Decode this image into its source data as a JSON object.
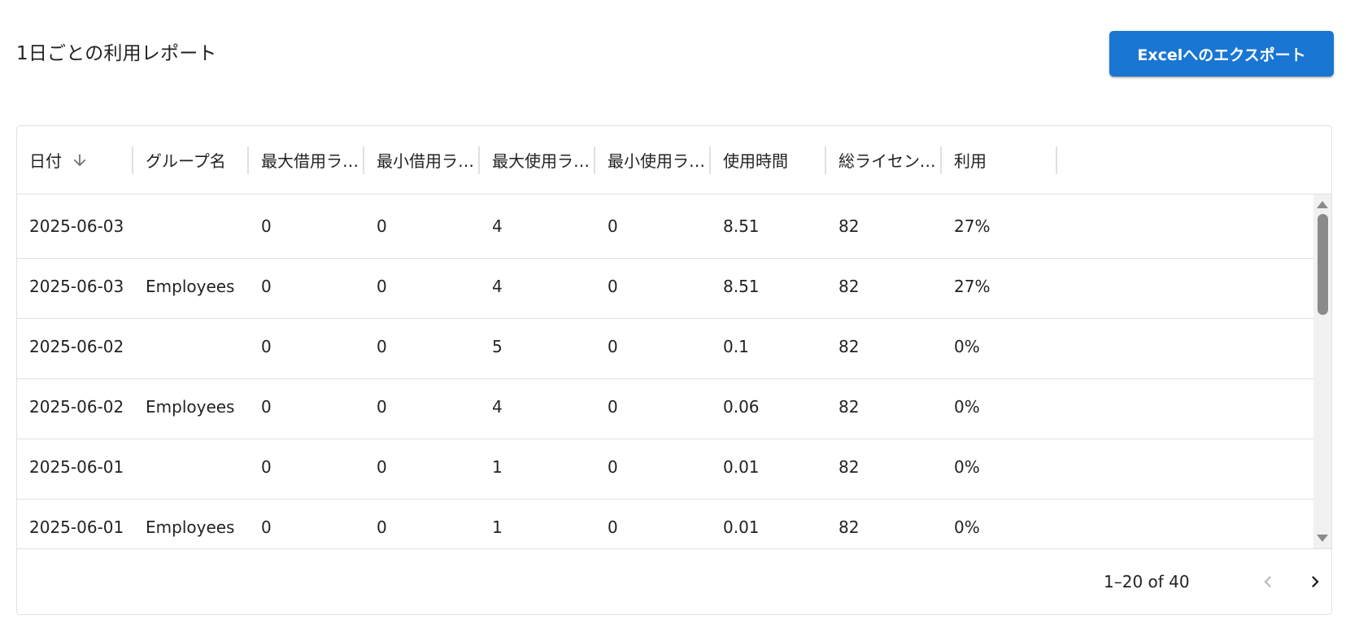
{
  "page": {
    "title": "1日ごとの利用レポート",
    "export_label": "Excelへのエクスポート"
  },
  "colors": {
    "primary": "#1976d2",
    "border": "#e0e0e0",
    "text": "#212121",
    "icon": "#757575",
    "disabled": "#bdbdbd"
  },
  "table": {
    "sort": {
      "column": "日付",
      "direction": "descending",
      "icon": "arrow-down-icon"
    },
    "columns": [
      {
        "key": "date",
        "label": "日付"
      },
      {
        "key": "group",
        "label": "グループ名"
      },
      {
        "key": "max_borrow",
        "label": "最大借用ライセンス"
      },
      {
        "key": "min_borrow",
        "label": "最小借用ライセンス"
      },
      {
        "key": "max_used",
        "label": "最大使用ライセンス"
      },
      {
        "key": "min_used",
        "label": "最小使用ライセンス"
      },
      {
        "key": "hours",
        "label": "使用時間"
      },
      {
        "key": "total",
        "label": "総ライセンス数"
      },
      {
        "key": "usage",
        "label": "利用"
      }
    ],
    "rows": [
      [
        "2025-06-03",
        "",
        "0",
        "0",
        "4",
        "0",
        "8.51",
        "82",
        "27%"
      ],
      [
        "2025-06-03",
        "Employees",
        "0",
        "0",
        "4",
        "0",
        "8.51",
        "82",
        "27%"
      ],
      [
        "2025-06-02",
        "",
        "0",
        "0",
        "5",
        "0",
        "0.1",
        "82",
        "0%"
      ],
      [
        "2025-06-02",
        "Employees",
        "0",
        "0",
        "4",
        "0",
        "0.06",
        "82",
        "0%"
      ],
      [
        "2025-06-01",
        "",
        "0",
        "0",
        "1",
        "0",
        "0.01",
        "82",
        "0%"
      ],
      [
        "2025-06-01",
        "Employees",
        "0",
        "0",
        "1",
        "0",
        "0.01",
        "82",
        "0%"
      ]
    ]
  },
  "pagination": {
    "range_text": "1–20 of 40",
    "prev_enabled": false,
    "next_enabled": true
  },
  "scrollbar": {
    "position": 0
  }
}
